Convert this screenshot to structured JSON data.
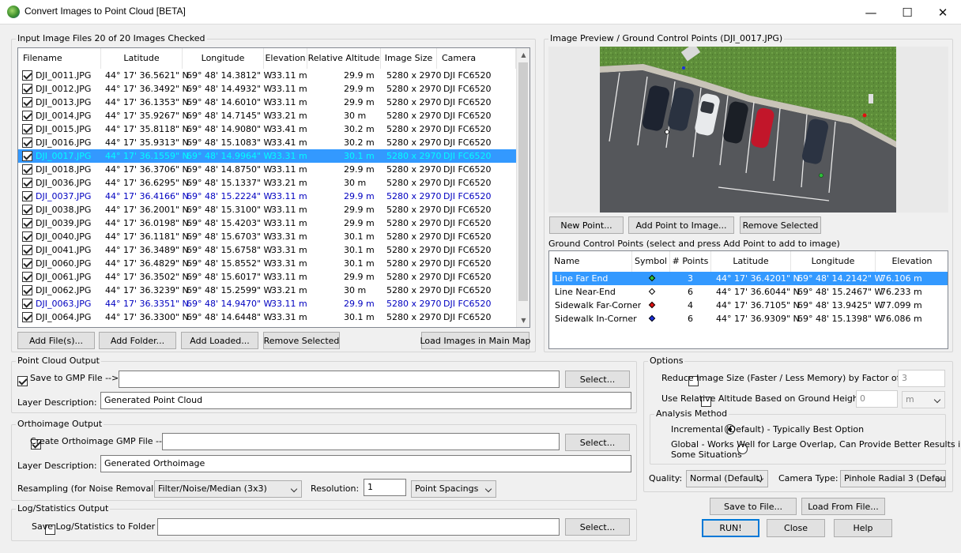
{
  "window": {
    "title": "Convert Images to Point Cloud [BETA]",
    "minimize": "—",
    "maximize": "☐",
    "close": "✕"
  },
  "input_files": {
    "group_label": "Input Image Files 20 of 20 Images Checked",
    "columns": [
      "Filename",
      "Latitude",
      "Longitude",
      "Elevation",
      "Relative Altitude",
      "Image Size",
      "Camera"
    ],
    "rows": [
      {
        "file": "DJI_0011.JPG",
        "lat": "44° 17' 36.5621\" N",
        "lon": "69° 48' 14.3812\" W",
        "elev": "33.11 m",
        "rel": "29.9 m",
        "size": "5280 x 2970",
        "cam": "DJI FC6520",
        "checked": true,
        "style": "normal"
      },
      {
        "file": "DJI_0012.JPG",
        "lat": "44° 17' 36.3492\" N",
        "lon": "69° 48' 14.4932\" W",
        "elev": "33.11 m",
        "rel": "29.9 m",
        "size": "5280 x 2970",
        "cam": "DJI FC6520",
        "checked": true,
        "style": "normal"
      },
      {
        "file": "DJI_0013.JPG",
        "lat": "44° 17' 36.1353\" N",
        "lon": "69° 48' 14.6010\" W",
        "elev": "33.11 m",
        "rel": "29.9 m",
        "size": "5280 x 2970",
        "cam": "DJI FC6520",
        "checked": true,
        "style": "normal"
      },
      {
        "file": "DJI_0014.JPG",
        "lat": "44° 17' 35.9267\" N",
        "lon": "69° 48' 14.7145\" W",
        "elev": "33.21 m",
        "rel": "30 m",
        "size": "5280 x 2970",
        "cam": "DJI FC6520",
        "checked": true,
        "style": "normal"
      },
      {
        "file": "DJI_0015.JPG",
        "lat": "44° 17' 35.8118\" N",
        "lon": "69° 48' 14.9080\" W",
        "elev": "33.41 m",
        "rel": "30.2 m",
        "size": "5280 x 2970",
        "cam": "DJI FC6520",
        "checked": true,
        "style": "normal"
      },
      {
        "file": "DJI_0016.JPG",
        "lat": "44° 17' 35.9313\" N",
        "lon": "69° 48' 15.1083\" W",
        "elev": "33.41 m",
        "rel": "30.2 m",
        "size": "5280 x 2970",
        "cam": "DJI FC6520",
        "checked": true,
        "style": "normal"
      },
      {
        "file": "DJI_0017.JPG",
        "lat": "44° 17' 36.1559\" N",
        "lon": "69° 48' 14.9964\" W",
        "elev": "33.31 m",
        "rel": "30.1 m",
        "size": "5280 x 2970",
        "cam": "DJI FC6520",
        "checked": true,
        "style": "selected"
      },
      {
        "file": "DJI_0018.JPG",
        "lat": "44° 17' 36.3706\" N",
        "lon": "69° 48' 14.8750\" W",
        "elev": "33.11 m",
        "rel": "29.9 m",
        "size": "5280 x 2970",
        "cam": "DJI FC6520",
        "checked": true,
        "style": "normal"
      },
      {
        "file": "DJI_0036.JPG",
        "lat": "44° 17' 36.6295\" N",
        "lon": "69° 48' 15.1337\" W",
        "elev": "33.21 m",
        "rel": "30 m",
        "size": "5280 x 2970",
        "cam": "DJI FC6520",
        "checked": true,
        "style": "normal"
      },
      {
        "file": "DJI_0037.JPG",
        "lat": "44° 17' 36.4166\" N",
        "lon": "69° 48' 15.2224\" W",
        "elev": "33.11 m",
        "rel": "29.9 m",
        "size": "5280 x 2970",
        "cam": "DJI FC6520",
        "checked": true,
        "style": "blue"
      },
      {
        "file": "DJI_0038.JPG",
        "lat": "44° 17' 36.2001\" N",
        "lon": "69° 48' 15.3100\" W",
        "elev": "33.11 m",
        "rel": "29.9 m",
        "size": "5280 x 2970",
        "cam": "DJI FC6520",
        "checked": true,
        "style": "normal"
      },
      {
        "file": "DJI_0039.JPG",
        "lat": "44° 17' 36.0198\" N",
        "lon": "69° 48' 15.4203\" W",
        "elev": "33.11 m",
        "rel": "29.9 m",
        "size": "5280 x 2970",
        "cam": "DJI FC6520",
        "checked": true,
        "style": "normal"
      },
      {
        "file": "DJI_0040.JPG",
        "lat": "44° 17' 36.1181\" N",
        "lon": "69° 48' 15.6703\" W",
        "elev": "33.31 m",
        "rel": "30.1 m",
        "size": "5280 x 2970",
        "cam": "DJI FC6520",
        "checked": true,
        "style": "normal"
      },
      {
        "file": "DJI_0041.JPG",
        "lat": "44° 17' 36.3489\" N",
        "lon": "69° 48' 15.6758\" W",
        "elev": "33.31 m",
        "rel": "30.1 m",
        "size": "5280 x 2970",
        "cam": "DJI FC6520",
        "checked": true,
        "style": "normal"
      },
      {
        "file": "DJI_0060.JPG",
        "lat": "44° 17' 36.4829\" N",
        "lon": "69° 48' 15.8552\" W",
        "elev": "33.31 m",
        "rel": "30.1 m",
        "size": "5280 x 2970",
        "cam": "DJI FC6520",
        "checked": true,
        "style": "normal"
      },
      {
        "file": "DJI_0061.JPG",
        "lat": "44° 17' 36.3502\" N",
        "lon": "69° 48' 15.6017\" W",
        "elev": "33.11 m",
        "rel": "29.9 m",
        "size": "5280 x 2970",
        "cam": "DJI FC6520",
        "checked": true,
        "style": "normal"
      },
      {
        "file": "DJI_0062.JPG",
        "lat": "44° 17' 36.3239\" N",
        "lon": "69° 48' 15.2599\" W",
        "elev": "33.21 m",
        "rel": "30 m",
        "size": "5280 x 2970",
        "cam": "DJI FC6520",
        "checked": true,
        "style": "normal"
      },
      {
        "file": "DJI_0063.JPG",
        "lat": "44° 17' 36.3351\" N",
        "lon": "69° 48' 14.9470\" W",
        "elev": "33.11 m",
        "rel": "29.9 m",
        "size": "5280 x 2970",
        "cam": "DJI FC6520",
        "checked": true,
        "style": "blue"
      },
      {
        "file": "DJI_0064.JPG",
        "lat": "44° 17' 36.3300\" N",
        "lon": "69° 48' 14.6448\" W",
        "elev": "33.31 m",
        "rel": "30.1 m",
        "size": "5280 x 2970",
        "cam": "DJI FC6520",
        "checked": true,
        "style": "normal"
      }
    ],
    "buttons": {
      "add_files": "Add File(s)...",
      "add_folder": "Add Folder...",
      "add_loaded": "Add Loaded...",
      "remove_selected": "Remove Selected",
      "load_main_map": "Load Images in Main Map"
    }
  },
  "preview": {
    "group_label": "Image Preview / Ground Control Points (DJI_0017.JPG)",
    "buttons": {
      "new_point": "New Point...",
      "add_point": "Add Point to Image...",
      "remove_selected": "Remove Selected"
    },
    "gcp_label": "Ground Control Points (select and press Add Point to add to image)",
    "gcp_columns": [
      "Name",
      "Symbol",
      "# Points",
      "Latitude",
      "Longitude",
      "Elevation"
    ],
    "gcp_rows": [
      {
        "name": "Line Far End",
        "points": "3",
        "lat": "44° 17' 36.4201\" N",
        "lon": "69° 48' 14.2142\" W",
        "elev": "76.106 m",
        "color": "#2fbf3a",
        "selected": true
      },
      {
        "name": "Line Near-End",
        "points": "6",
        "lat": "44° 17' 36.6044\" N",
        "lon": "69° 48' 15.2467\" W",
        "elev": "76.233 m",
        "color": "#ffffff",
        "selected": false
      },
      {
        "name": "Sidewalk Far-Corner",
        "points": "4",
        "lat": "44° 17' 36.7105\" N",
        "lon": "69° 48' 13.9425\" W",
        "elev": "77.099 m",
        "color": "#e01010",
        "selected": false
      },
      {
        "name": "Sidewalk In-Corner",
        "points": "6",
        "lat": "44° 17' 36.9309\" N",
        "lon": "69° 48' 15.1398\" W",
        "elev": "76.086 m",
        "color": "#1a2fe0",
        "selected": false
      }
    ]
  },
  "point_cloud": {
    "group_label": "Point Cloud Output",
    "save_label": "Save to GMP File -->",
    "save_checked": true,
    "path": "",
    "select": "Select...",
    "desc_label": "Layer Description:",
    "desc_value": "Generated Point Cloud"
  },
  "ortho": {
    "group_label": "Orthoimage Output",
    "create_label": "Create Orthoimage GMP File -->",
    "create_checked": true,
    "path": "",
    "select": "Select...",
    "desc_label": "Layer Description:",
    "desc_value": "Generated Orthoimage",
    "resampling_label": "Resampling (for Noise Removal):",
    "resampling_value": "Filter/Noise/Median (3x3)",
    "resolution_label": "Resolution:",
    "resolution_value": "1",
    "spacing_value": "Point Spacings"
  },
  "log": {
    "group_label": "Log/Statistics Output",
    "save_label": "Save Log/Statistics to Folder",
    "save_checked": false,
    "path": "",
    "select": "Select..."
  },
  "options": {
    "group_label": "Options",
    "reduce_label": "Reduce Image Size (Faster / Less Memory) by Factor of",
    "reduce_checked": false,
    "reduce_value": "3",
    "relalt_label": "Use Relative Altitude Based on Ground Height of",
    "relalt_checked": false,
    "relalt_value": "0",
    "relalt_unit": "m",
    "analysis_label": "Analysis Method",
    "incremental_label": "Incremental (Default) - Typically Best Option",
    "global_label_1": "Global - Works Well for Large Overlap, Can Provide Better Results in",
    "global_label_2": "Some Situations",
    "quality_label": "Quality:",
    "quality_value": "Normal (Default)",
    "camera_label": "Camera Type:",
    "camera_value": "Pinhole Radial 3 (Defau"
  },
  "footer": {
    "save_to_file": "Save to File...",
    "load_from_file": "Load From File...",
    "run": "RUN!",
    "close": "Close",
    "help": "Help"
  },
  "colors": {
    "accent": "#0078d7",
    "selected_row": "#3399ff",
    "selected_text": "#00ffff",
    "blue_text": "#0000c0"
  }
}
